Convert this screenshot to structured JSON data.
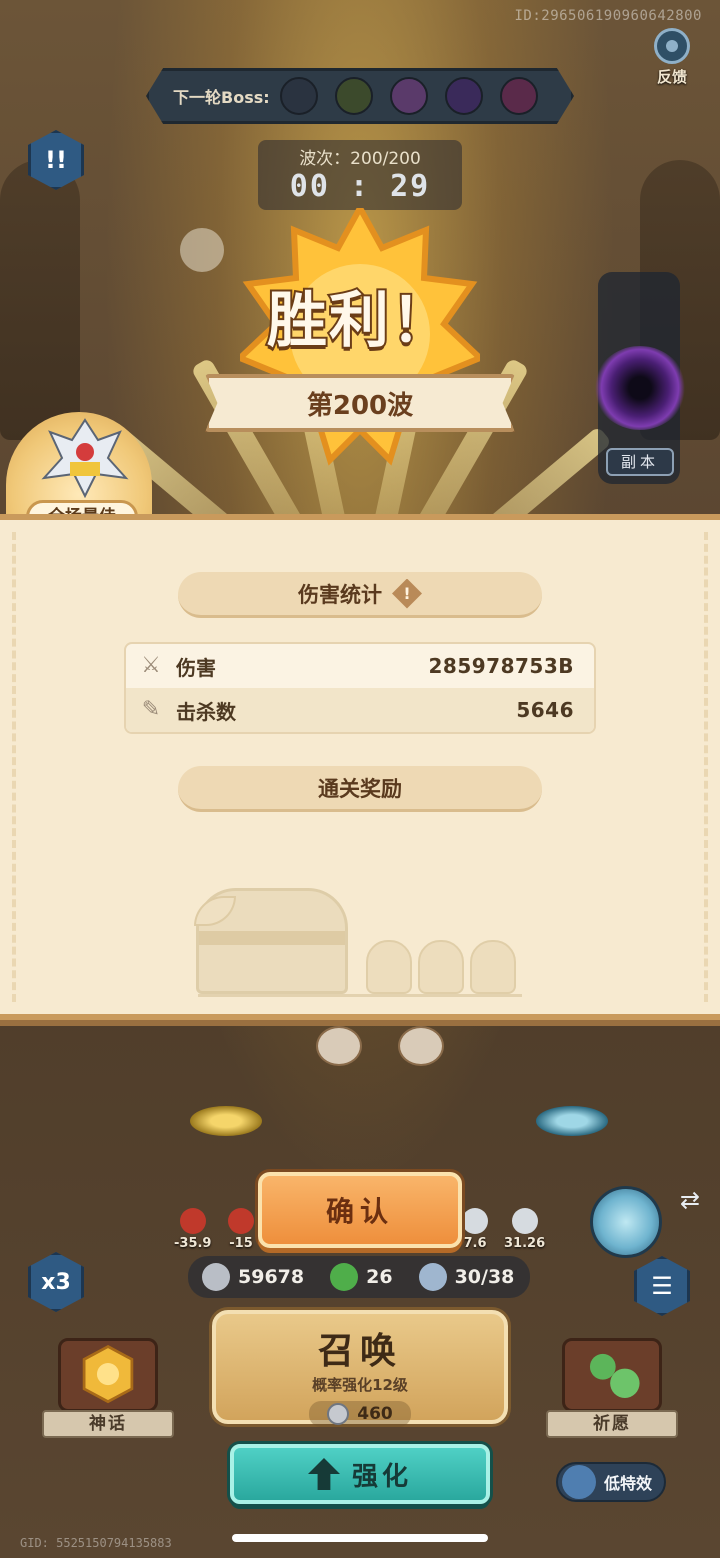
{
  "top_id": "ID:296506190960642800",
  "feedback": {
    "label": "反馈",
    "icon": "gear-icon"
  },
  "boss_bar": {
    "label": "下一轮Boss:",
    "bosses": [
      {
        "icon": "boss-1-icon",
        "color": "#2a3340"
      },
      {
        "icon": "boss-2-icon",
        "color": "#3c4a2c"
      },
      {
        "icon": "boss-3-icon",
        "color": "#5a3a6a"
      },
      {
        "icon": "boss-4-icon",
        "color": "#3a2a5a"
      },
      {
        "icon": "boss-5-icon",
        "color": "#5a2a4a"
      }
    ]
  },
  "alert_button": {
    "icon": "alert-icon",
    "label": "!!"
  },
  "wave": {
    "label": "波次：200/200",
    "timer": "00 : 29"
  },
  "victory": {
    "title": "胜利！",
    "wave_label": "第200波"
  },
  "dungeon": {
    "label": "副本"
  },
  "mvp": {
    "label": "全场最佳"
  },
  "damage_stats": {
    "header": "伤害统计",
    "rows": [
      {
        "icon": "sword-icon",
        "name": "伤害",
        "value": "285978753B"
      },
      {
        "icon": "kill-icon",
        "name": "击杀数",
        "value": "5646"
      }
    ]
  },
  "rewards": {
    "header": "通关奖励"
  },
  "confirm": {
    "label": "确认"
  },
  "enemy_stats": [
    {
      "value": "-35.9",
      "color": "#c0392b"
    },
    {
      "value": "-15",
      "color": "#c0392b"
    },
    {
      "value": "7.6",
      "color": "#d6dbe0"
    },
    {
      "value": "31.26",
      "color": "#d6dbe0"
    }
  ],
  "resources": [
    {
      "icon": "silver-coin-icon",
      "value": "59678",
      "color": "#b9bec6"
    },
    {
      "icon": "clover-icon",
      "value": "26",
      "color": "#4fae4a"
    },
    {
      "icon": "soul-icon",
      "value": "30/38",
      "color": "#9fb6cf"
    }
  ],
  "speed": {
    "label": "x3"
  },
  "menu": {
    "icon": "menu-icon"
  },
  "summon": {
    "title": "召唤",
    "subtitle": "概率强化12级",
    "cost": "460"
  },
  "myth": {
    "label": "神话"
  },
  "wish": {
    "label": "祈愿"
  },
  "upgrade": {
    "label": "强化"
  },
  "low_effects": {
    "label": "低特效"
  },
  "gid": "GID: 552515079413588З",
  "colors": {
    "panel": "#f7ead0",
    "accent_orange": "#ee8f3c",
    "accent_teal": "#2aa89e"
  }
}
